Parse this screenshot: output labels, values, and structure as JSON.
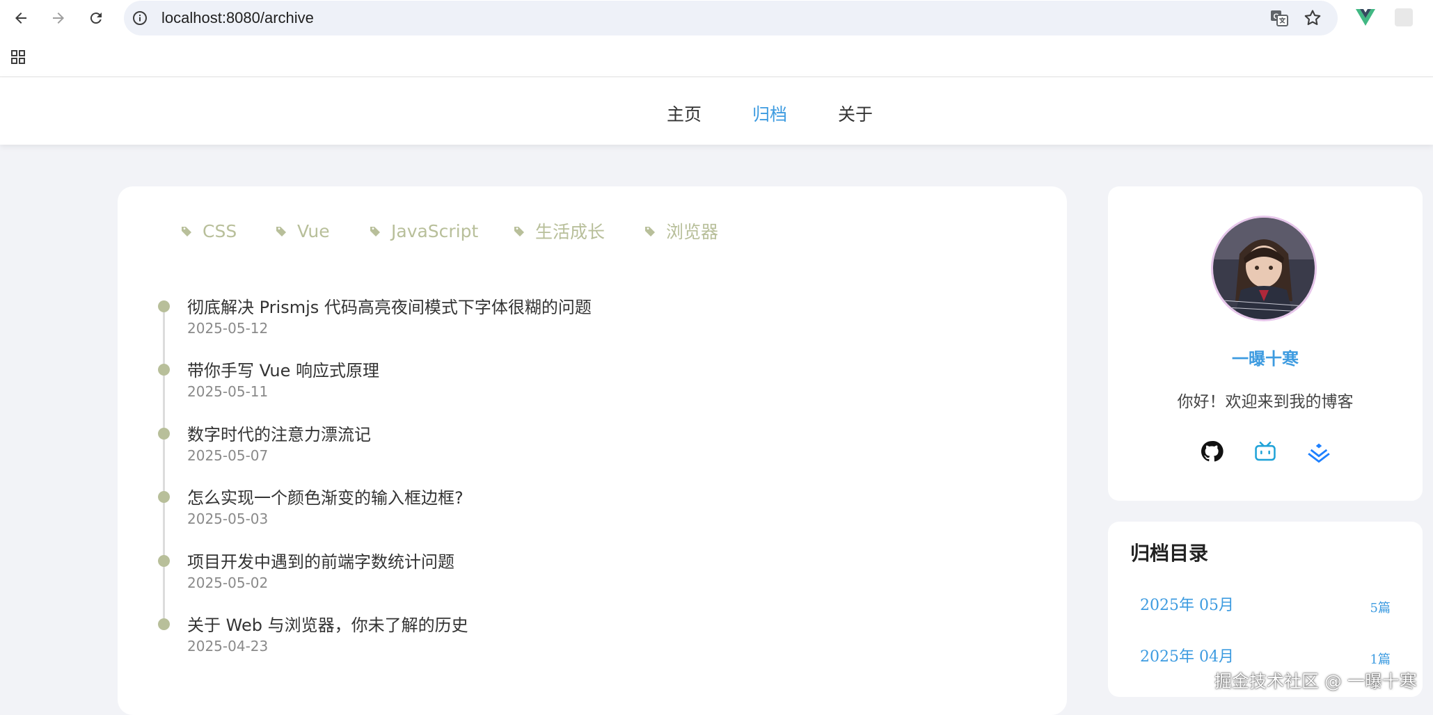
{
  "browser": {
    "url": "localhost:8080/archive",
    "nav_icons": [
      "back-arrow-icon",
      "forward-arrow-icon",
      "reload-icon"
    ],
    "omnibox_icons": [
      "site-info-icon",
      "translate-icon",
      "bookmark-star-icon"
    ],
    "extension_icons": [
      "vue-devtools-icon",
      "extension-icon"
    ],
    "bookmarks_icon": "apps-grid-icon"
  },
  "site_nav": {
    "items": [
      {
        "label": "主页",
        "active": false
      },
      {
        "label": "归档",
        "active": true
      },
      {
        "label": "关于",
        "active": false
      }
    ],
    "active_color": "#3d9be0"
  },
  "tags": [
    {
      "label": "CSS"
    },
    {
      "label": "Vue"
    },
    {
      "label": "JavaScript"
    },
    {
      "label": "生活成长"
    },
    {
      "label": "浏览器"
    }
  ],
  "tag_color": "#b8bf9a",
  "posts": [
    {
      "title": "彻底解决 Prismjs 代码高亮夜间模式下字体很糊的问题",
      "date": "2025-05-12"
    },
    {
      "title": "带你手写 Vue 响应式原理",
      "date": "2025-05-11"
    },
    {
      "title": "数字时代的注意力漂流记",
      "date": "2025-05-07"
    },
    {
      "title": "怎么实现一个颜色渐变的输入框边框?",
      "date": "2025-05-03"
    },
    {
      "title": "项目开发中遇到的前端字数统计问题",
      "date": "2025-05-02"
    },
    {
      "title": "关于 Web 与浏览器，你未了解的历史",
      "date": "2025-04-23"
    }
  ],
  "profile": {
    "name": "一曝十寒",
    "bio": "你好！欢迎来到我的博客",
    "social_icons": [
      "github-icon",
      "bilibili-icon",
      "juejin-icon"
    ]
  },
  "archive": {
    "title": "归档目录",
    "months": [
      {
        "month": "2025年 05月",
        "count": "5篇"
      },
      {
        "month": "2025年 04月",
        "count": "1篇"
      }
    ]
  },
  "watermark": "掘金技术社区 @ 一曝十寒"
}
